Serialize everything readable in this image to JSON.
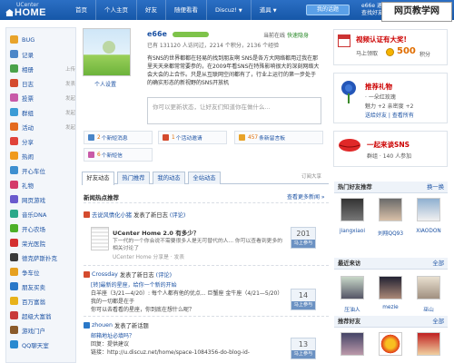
{
  "header": {
    "logo_small": "UCenter",
    "logo_big": "HOME",
    "nav": [
      "首页",
      "个人主页",
      "好友",
      "随便看看",
      "Discuz!",
      "道具"
    ],
    "button": "我的话题",
    "user_line1": "e66e 退出",
    "user_line2": "查找好友",
    "watermark": "网页教学网"
  },
  "sidebar": {
    "items": [
      {
        "label": "BUG",
        "extra": "",
        "color": "#e8a32a"
      },
      {
        "label": "记录",
        "extra": "",
        "color": "#4a86c8"
      },
      {
        "label": "相册",
        "extra": "上传",
        "color": "#4aa24a"
      },
      {
        "label": "日志",
        "extra": "发表",
        "color": "#d44b2e"
      },
      {
        "label": "投票",
        "extra": "发起",
        "color": "#c85aa8"
      },
      {
        "label": "群组",
        "extra": "发起",
        "color": "#3a9bd6"
      },
      {
        "label": "活动",
        "extra": "发起",
        "color": "#e46a1e"
      },
      {
        "label": "分享",
        "extra": "",
        "color": "#e0433a"
      },
      {
        "label": "热闹",
        "extra": "",
        "color": "#f09a1c"
      },
      {
        "label": "开心车位",
        "extra": "",
        "color": "#3d8fd0"
      },
      {
        "label": "礼物",
        "extra": "",
        "color": "#d43a6a"
      },
      {
        "label": "网页游戏",
        "extra": "",
        "color": "#6a5acd"
      },
      {
        "label": "音乐DNA",
        "extra": "",
        "color": "#2aa88a"
      },
      {
        "label": "开心农场",
        "extra": "",
        "color": "#4caf28"
      },
      {
        "label": "荣光医院",
        "extra": "",
        "color": "#d43030"
      },
      {
        "label": "德克萨斯扑克",
        "extra": "",
        "color": "#3a3a3a"
      },
      {
        "label": "争车位",
        "extra": "",
        "color": "#e6a020"
      },
      {
        "label": "朋友买卖",
        "extra": "",
        "color": "#2a78c8"
      },
      {
        "label": "百万富翁",
        "extra": "",
        "color": "#e8b21a"
      },
      {
        "label": "超级大富翁",
        "extra": "",
        "color": "#c83a3a"
      },
      {
        "label": "游戏门户",
        "extra": "",
        "color": "#8a5a2a"
      },
      {
        "label": "QQ聊天室",
        "extra": "",
        "color": "#2a8ad0"
      }
    ]
  },
  "profile": {
    "avatar_label": "个人设置",
    "name": "e66e",
    "status_label": "当前在线",
    "status_value": "快速隐身",
    "stats": "已有 131120 人访问过，2214 个积分，2136 个经验",
    "intro": "有SNS的世界都都在轻易的找到朋友啊 SNS是各方大网络都用过我在那里天天来都常常要参的，在2009年看SNS在特殊影响很大的深刻网络大会大会的上合作。只是从互联网空间都有了，行业上运行的第一步处于的确实形态的新视野的SNS开放机",
    "mood_placeholder": "你可以更新状态，让好友们知道你在做什么..."
  },
  "quick": [
    {
      "num": "2",
      "label": "个新短消息",
      "color": "#4a86c8"
    },
    {
      "num": "1",
      "label": "个活动邀请",
      "color": "#d44b2e"
    },
    {
      "num": "457",
      "label": "条新留言板",
      "color": "#e8a32a"
    },
    {
      "num": "6",
      "label": "个新短信",
      "color": "#c85aa8"
    }
  ],
  "tabs": {
    "items": [
      "好友动态",
      "热门推荐",
      "我的动态",
      "全站动态"
    ],
    "rss": "订阅大享"
  },
  "feed": {
    "heading": "新闻热点推荐",
    "more": "查看更多新闻 »",
    "item1": {
      "who": "去说风情化小猪",
      "text": "发表了新日志",
      "comment": "(评论)"
    },
    "blog_title": "UCenter Home 2.0 有多少？",
    "blog_desc": "下一代的一个你会说不需要很多人是无可替代的人... 你可以查看到更多的相关讨论了",
    "blog_note": "UCenter Home 分享是 · 发表",
    "vote1": {
      "num": "201",
      "label": "马上参与"
    },
    "item2": {
      "who": "Crossday",
      "text": "发表了新日志",
      "comment": "(评论)"
    },
    "snip2_title": "[转]最新的星座，给你一个新的开始",
    "snip2_line1": "白羊座（3/21—4/20）: 每个人都有他的优点... 巨蟹座 金牛座（4/21—5/20）我的一切都是在于",
    "snip2_line2": "你可以去看看的星座，你到底在想什么呢？",
    "vote2": {
      "num": "14",
      "label": "马上参与"
    },
    "item3": {
      "who": "zhouen",
      "text": "发表了新话题",
      "comment": ""
    },
    "snip3_title": "邮箱地址必填吗？",
    "snip3_line1": "回复：提供建议",
    "snip3_line2": "链接：http://u.discuz.net/home/space-1084356-do-blog-id-",
    "vote3": {
      "num": "13",
      "label": "马上参与"
    }
  },
  "right": {
    "cert_title": "视频认证有大奖!",
    "cert_sub": "马上领取",
    "cert_score": "500",
    "cert_unit": "积分",
    "gift_title": "推荐礼物",
    "gift_l1": "· 一朵红玫瑰",
    "gift_l2": "魅力 +2  亲密度 +2",
    "gift_l3": "送给好友 | 查看所有",
    "sns_title": "一起来谈SNS",
    "sns_sub": "群组 · 140 人参加",
    "friends_title": "热门好友推荐",
    "friends_more": "换一换",
    "friends": [
      "jiangxiaoi",
      "刘翔QQ93",
      "XIAODON"
    ],
    "visitors_title": "最近来访",
    "visitors_more": "全部",
    "visitors": [
      "压油人",
      "mezie",
      "巫山"
    ],
    "bottom_title": "推荐好友",
    "bottom_more": "全部"
  }
}
